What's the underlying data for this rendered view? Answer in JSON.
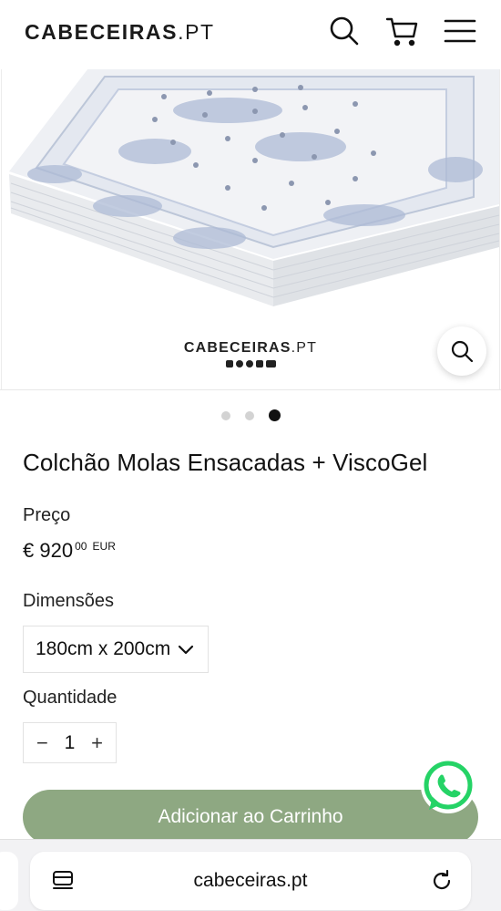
{
  "header": {
    "brand_bold": "CABECEIRAS",
    "brand_light": ".PT",
    "icons": [
      "search-icon",
      "cart-icon",
      "menu-icon"
    ]
  },
  "gallery": {
    "image_brand_bold": "CABECEIRAS",
    "image_brand_light": ".PT",
    "slides_total": 3,
    "active_slide": 3,
    "zoom_icon": "zoom-icon"
  },
  "product": {
    "title": "Colchão Molas Ensacadas + ViscoGel",
    "price_label": "Preço",
    "price_main": "€ 920",
    "price_cents": "00",
    "price_currency": "EUR",
    "dimensions_label": "Dimensões",
    "dimensions_value": "180cm x 200cm",
    "quantity_label": "Quantidade",
    "quantity_minus": "−",
    "quantity_value": "1",
    "quantity_plus": "+",
    "add_to_cart": "Adicionar ao Carrinho"
  },
  "colors": {
    "accent": "#8ea882",
    "whatsapp": "#25d366"
  },
  "browser": {
    "url": "cabeceiras.pt",
    "icons": [
      "tabs-icon",
      "reload-icon"
    ]
  }
}
